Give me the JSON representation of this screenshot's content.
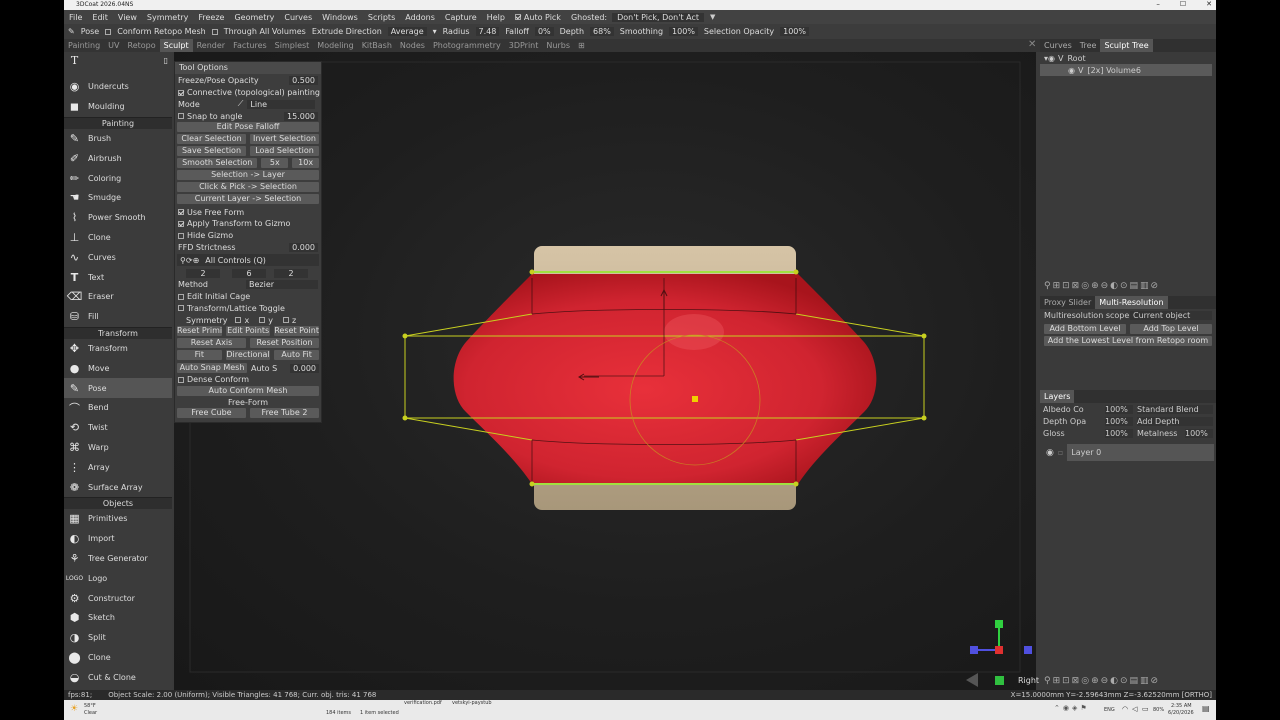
{
  "window": {
    "title": "3DCoat 2026.04NS",
    "controls": [
      "–",
      "☐",
      "✕"
    ]
  },
  "menu": [
    "File",
    "Edit",
    "View",
    "Symmetry",
    "Freeze",
    "Geometry",
    "Curves",
    "Windows",
    "Scripts",
    "Addons",
    "Capture",
    "Help"
  ],
  "menu_auto_pick": "Auto Pick",
  "menu_ghosted": "Ghosted:",
  "menu_ghosted_value": "Don't Pick, Don't Act",
  "toolbar": {
    "pose": "Pose",
    "conform": "Conform Retopo Mesh",
    "through": "Through All Volumes",
    "extrude": "Extrude Direction",
    "extrude_val": "Average",
    "radius": "Radius",
    "radius_val": "7.48",
    "falloff": "Falloff",
    "falloff_val": "0%",
    "depth": "Depth",
    "depth_val": "68%",
    "smoothing": "Smoothing",
    "smoothing_val": "100%",
    "selopacity": "Selection Opacity",
    "selopacity_val": "100%"
  },
  "room_tabs": [
    "Painting",
    "UV",
    "Retopo",
    "Sculpt",
    "Render",
    "Factures",
    "Simplest",
    "Modeling",
    "KitBash",
    "Nodes",
    "Photogrammetry",
    "3DPrint",
    "Nurbs"
  ],
  "active_room": "Sculpt",
  "left_tools": {
    "group0": [
      "Undercuts",
      "Moulding"
    ],
    "painting_label": "Painting",
    "painting": [
      "Brush",
      "Airbrush",
      "Coloring",
      "Smudge",
      "Power Smooth",
      "Clone",
      "Curves",
      "Text",
      "Eraser",
      "Fill"
    ],
    "transform_label": "Transform",
    "transform": [
      "Transform",
      "Move",
      "Pose",
      "Bend",
      "Twist",
      "Warp",
      "Array",
      "Surface Array"
    ],
    "objects_label": "Objects",
    "objects": [
      "Primitives",
      "Import",
      "Tree Generator",
      "Logo",
      "Constructor",
      "Sketch",
      "Split",
      "Clone",
      "Cut & Clone"
    ],
    "active": "Pose"
  },
  "tool_options": {
    "title": "Tool Options",
    "freeze_opacity": "Freeze/Pose Opacity",
    "freeze_opacity_val": "0.500",
    "connective": "Connective (topological) painting",
    "mode": "Mode",
    "mode_val": "Line",
    "snap": "Snap to angle",
    "snap_val": "15.000",
    "edit_pose": "Edit Pose Falloff",
    "clear_sel": "Clear Selection",
    "invert_sel": "Invert Selection",
    "save_sel": "Save Selection",
    "load_sel": "Load Selection",
    "smooth_sel": "Smooth Selection",
    "x5": "5x",
    "x10": "10x",
    "sel_layer": "Selection -> Layer",
    "click_pick": "Click & Pick -> Selection",
    "cur_layer": "Current Layer -> Selection",
    "use_ff": "Use Free Form",
    "apply_tg": "Apply Transform to Gizmo",
    "hide_gizmo": "Hide Gizmo",
    "ffd": "FFD Strictness",
    "ffd_val": "0.000",
    "all_controls": "All Controls (Q)",
    "n1": "2",
    "n2": "6",
    "n3": "2",
    "method": "Method",
    "method_val": "Bezier",
    "edit_cage": "Edit Initial Cage",
    "lattice": "Transform/Lattice Toggle",
    "symmetry": "Symmetry",
    "sx": "x",
    "sy": "y",
    "sz": "z",
    "reset_prim": "Reset Primi",
    "edit_points": "Edit Points",
    "reset_point": "Reset Point",
    "reset_axis": "Reset Axis",
    "reset_position": "Reset Position",
    "fit": "Fit",
    "directional": "Directional",
    "auto_fit": "Auto Fit",
    "auto_snap": "Auto Snap Mesh",
    "auto_s": "Auto S",
    "auto_s_val": "0.000",
    "dense": "Dense Conform",
    "auto_conform": "Auto Conform Mesh",
    "free_form": "Free-Form",
    "free_cube": "Free Cube",
    "free_tube": "Free Tube 2"
  },
  "right": {
    "tabs": [
      "Curves",
      "Tree",
      "Sculpt Tree"
    ],
    "active_tab": "Sculpt Tree",
    "root": "Root",
    "volume": "[2x] Volume6",
    "mr_tabs": [
      "Proxy Slider",
      "Multi-Resolution"
    ],
    "mr_active": "Multi-Resolution",
    "mr_scope": "Multiresolution scope",
    "mr_scope_val": "Current object",
    "add_bottom": "Add Bottom Level",
    "add_top": "Add Top Level",
    "add_lowest": "Add the Lowest Level from Retopo room",
    "layers_tab": "Layers",
    "albedo": "Albedo Co",
    "albedo_val": "100%",
    "blend": "Standard Blend",
    "depth": "Depth Opa",
    "depth_val": "100%",
    "depth_mode": "Add Depth",
    "gloss": "Gloss",
    "gloss_val": "100%",
    "metal": "Metalness",
    "metal_val": "100%",
    "layer0": "Layer 0"
  },
  "viewport": {
    "view_label": "Right"
  },
  "status": {
    "left": "fps:81;",
    "mid": "Object Scale: 2.00 (Uniform); Visible Triangles: 41 768; Curr. obj. tris: 41 768",
    "coords": "X=15.0000mm  Y=-2.59643mm  Z=-3.62520mm  [ORTHO]"
  },
  "taskbar": {
    "weather_temp": "58°F",
    "weather": "Clear",
    "items": "184 items",
    "selected": "1 item selected",
    "file1": "verification.pdf",
    "file2": "vetskyi-paystub",
    "lang": "ENG",
    "battery": "80%",
    "time": "2:35 AM",
    "date": "6/20/2026"
  },
  "colors": {
    "accent": "#e8303a",
    "cage": "#c8d020",
    "cap": "#cbb89a"
  }
}
